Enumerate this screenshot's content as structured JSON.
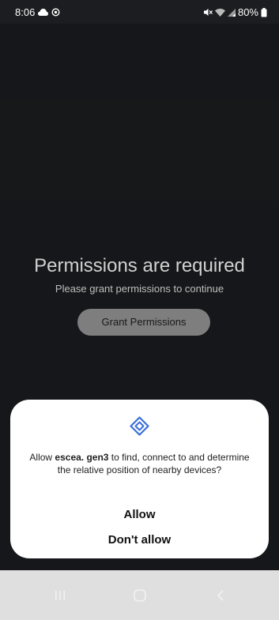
{
  "status_bar": {
    "time": "8:06",
    "battery": "80%",
    "left_icons": [
      "cloud-icon",
      "location-icon"
    ],
    "right_icons": [
      "mute-icon",
      "wifi-icon",
      "signal-icon",
      "battery-icon"
    ]
  },
  "app_screen": {
    "title": "Permissions are required",
    "subtitle": "Please grant permissions to continue",
    "grant_button_label": "Grant Permissions"
  },
  "dialog": {
    "icon": "nearby-devices-icon",
    "message_prefix": "Allow ",
    "app_name": "escea. gen3",
    "message_suffix": " to find, connect to and determine the relative position of nearby devices?",
    "allow_label": "Allow",
    "deny_label": "Don't allow",
    "accent_color": "#3b6fd8"
  },
  "nav_bar": {
    "buttons": [
      "recents-icon",
      "home-icon",
      "back-icon"
    ]
  }
}
